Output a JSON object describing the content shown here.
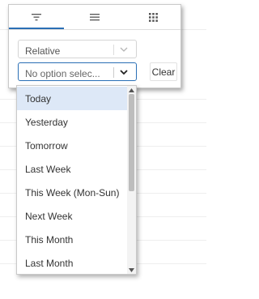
{
  "tabs": [
    {
      "icon": "filter-icon",
      "active": true
    },
    {
      "icon": "list-icon",
      "active": false
    },
    {
      "icon": "grid-icon",
      "active": false
    }
  ],
  "period_select": {
    "value": "Relative"
  },
  "option_select": {
    "value": "No option selec..."
  },
  "clear_button": {
    "label": "Clear"
  },
  "dropdown": {
    "items": [
      {
        "label": "Today",
        "selected": true
      },
      {
        "label": "Yesterday"
      },
      {
        "label": "Tomorrow"
      },
      {
        "label": "Last Week"
      },
      {
        "label": "This Week (Mon-Sun)"
      },
      {
        "label": "Next Week"
      },
      {
        "label": "This Month"
      },
      {
        "label": "Last Month"
      }
    ]
  },
  "colors": {
    "accent": "#2a6fb5",
    "selected_item_bg": "#dde8f7"
  }
}
